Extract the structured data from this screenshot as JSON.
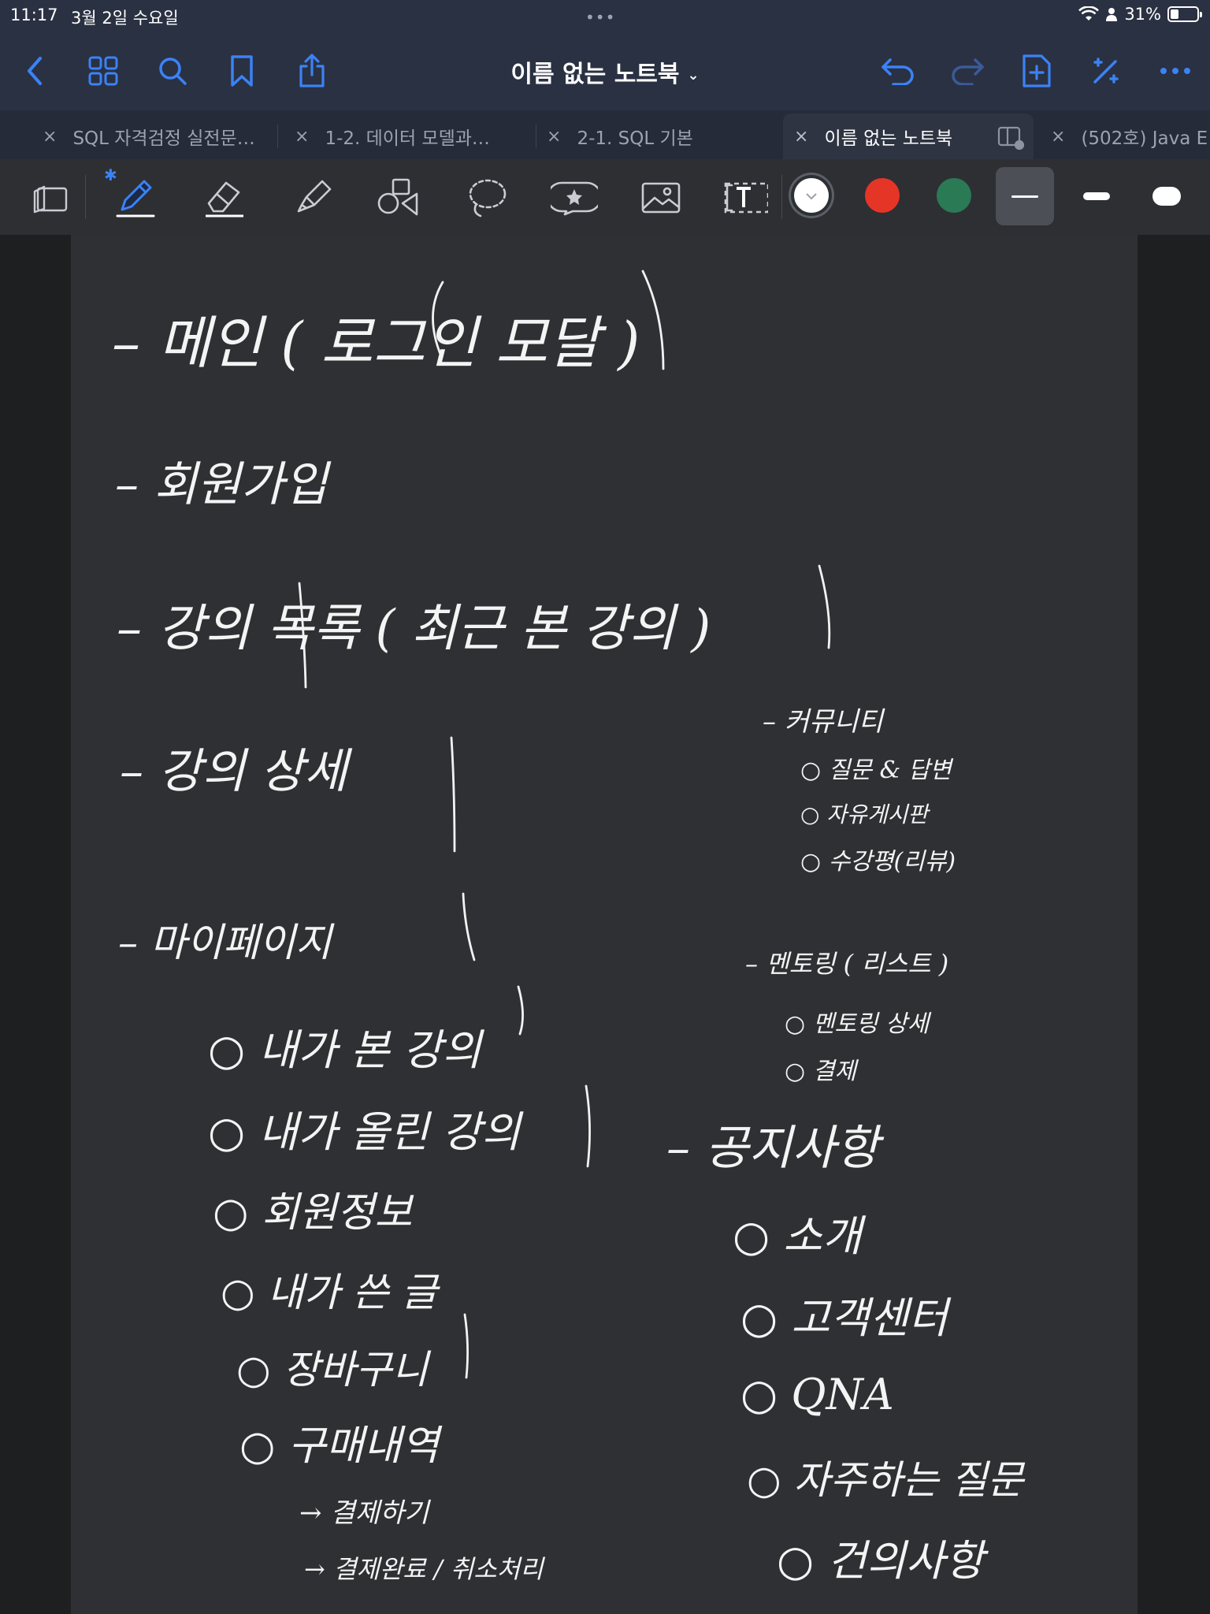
{
  "status_bar": {
    "time": "11:17",
    "date": "3월 2일 수요일",
    "multitask": "•••",
    "battery_percent": "31%",
    "battery_level": 0.31
  },
  "nav": {
    "title": "이름 없는 노트북",
    "title_chevron": "⌄",
    "icons": [
      "back-chevron-icon",
      "grid-icon",
      "search-icon",
      "bookmark-icon",
      "share-icon",
      "undo-icon",
      "redo-icon",
      "add-page-icon",
      "ai-sparkle-icon",
      "more-icon"
    ]
  },
  "tabs": [
    {
      "close": "×",
      "label": "SQL 자격검정 실전문…",
      "active": false
    },
    {
      "close": "×",
      "label": "1-2. 데이터 모델과…",
      "active": false
    },
    {
      "close": "×",
      "label": "2-1. SQL 기본",
      "active": false
    },
    {
      "close": "×",
      "label": "이름 없는 노트북",
      "active": true
    },
    {
      "close": "×",
      "label": "(502호) Java E",
      "active": false
    }
  ],
  "toolbar": {
    "tools": [
      "read-mode-icon",
      "pen-icon",
      "eraser-icon",
      "highlighter-icon",
      "shapes-icon",
      "lasso-icon",
      "sticker-icon",
      "image-icon",
      "text-icon"
    ],
    "bluetooth": "✱",
    "colors": [
      "#ffffff",
      "#e53527",
      "#2a7a55"
    ],
    "selected_color": "#ffffff",
    "selected_width": "thin"
  },
  "note": {
    "lines": [
      "– 메인 ( 로그인 모달 )",
      "– 회원가입",
      "– 강의 목록 ( 최근 본 강의 )",
      "– 강의 상세",
      "– 마이페이지",
      "○ 내가 본 강의",
      "○ 내가 올린 강의",
      "○ 회원정보",
      "○ 내가 쓴 글",
      "○ 장바구니",
      "○ 구매내역",
      "→ 결제하기",
      "→ 결제완료 / 취소처리",
      "– 커뮤니티",
      "○ 질문 & 답변",
      "○ 자유게시판",
      "○ 수강평(리뷰)",
      "– 멘토링 ( 리스트 )",
      "○ 멘토링 상세",
      "○ 결제",
      "– 공지사항",
      "○ 소개",
      "○ 고객센터",
      "○ QNA",
      "○ 자주하는 질문",
      "○ 건의사항"
    ]
  }
}
